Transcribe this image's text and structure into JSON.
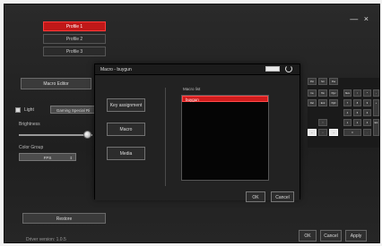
{
  "window": {
    "minimize": "—",
    "close": "×"
  },
  "profiles": [
    "Profile 1",
    "Profile 2",
    "Profile 3"
  ],
  "macro_editor_label": "Macro Editor",
  "light": {
    "label": "Light",
    "mode": "Gaming Special Ri",
    "checked": true
  },
  "brightness": {
    "label": "Brightness",
    "level": 0.9
  },
  "color_group": {
    "label": "Color Group",
    "value": "FPS"
  },
  "restore_label": "Restore",
  "driver_version": "Driver version: 1.0.5",
  "footer": {
    "ok": "OK",
    "cancel": "Cancel",
    "apply": "Apply"
  },
  "dialog": {
    "title": "Macro - buygun",
    "buttons": [
      "Key assignment",
      "Macro",
      "Media"
    ],
    "macro_list_label": "Macro list",
    "macro_items": [
      "buygun"
    ],
    "ok": "OK",
    "cancel": "Cancel"
  },
  "keypad": {
    "row0": [
      "Pnt",
      "Scr",
      "Pse"
    ],
    "row1": [
      "Ins",
      "Hm",
      "PgU",
      "Num",
      "/",
      "*",
      "-"
    ],
    "row2": [
      "Del",
      "End",
      "PgD",
      "7",
      "8",
      "9",
      "+"
    ],
    "row3": [
      "4",
      "5",
      "6"
    ],
    "row4": [
      "↑",
      "1",
      "2",
      "3",
      "Ent"
    ],
    "row5": [
      "←",
      "↓",
      "→",
      "0",
      "."
    ]
  },
  "colors": {
    "accent": "#c01818",
    "bg": "#222222"
  }
}
